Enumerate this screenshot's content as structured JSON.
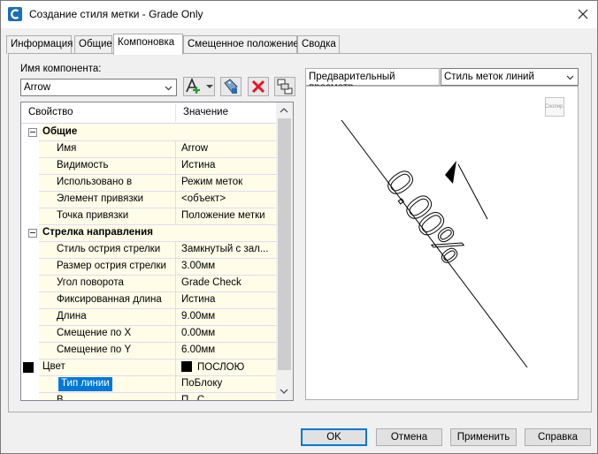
{
  "window": {
    "title": "Создание стиля метки - Grade Only"
  },
  "tabs": [
    {
      "label": "Информация"
    },
    {
      "label": "Общие"
    },
    {
      "label": "Компоновка"
    },
    {
      "label": "Смещенное положение"
    },
    {
      "label": "Сводка"
    }
  ],
  "active_tab": "Компоновка",
  "component": {
    "label": "Имя компонента:",
    "value": "Arrow"
  },
  "grid": {
    "headers": {
      "property": "Свойство",
      "value": "Значение"
    },
    "categories": [
      {
        "title": "Общие",
        "rows": [
          {
            "name": "Имя",
            "value": "Arrow"
          },
          {
            "name": "Видимость",
            "value": "Истина"
          },
          {
            "name": "Использовано в",
            "value": "Режим меток"
          },
          {
            "name": "Элемент привязки",
            "value": "<объект>"
          },
          {
            "name": "Точка привязки",
            "value": "Положение метки"
          }
        ]
      },
      {
        "title": "Стрелка направления",
        "rows": [
          {
            "name": "Стиль острия стрелки",
            "value": "Замкнутый с зал..."
          },
          {
            "name": "Размер острия стрелки",
            "value": "3.00мм"
          },
          {
            "name": "Угол поворота",
            "value": "Grade Check"
          },
          {
            "name": "Фиксированная длина",
            "value": "Истина"
          },
          {
            "name": "Длина",
            "value": "9.00мм"
          },
          {
            "name": "Смещение по X",
            "value": "0.00мм"
          },
          {
            "name": "Смещение по Y",
            "value": "6.00мм"
          },
          {
            "name": "Цвет",
            "value": "ПОСЛОЮ"
          },
          {
            "name": "Тип линии",
            "value": "ПоБлоку"
          },
          {
            "name": "В...",
            "value": "П...С..."
          }
        ]
      }
    ],
    "selected_row": "Тип линии"
  },
  "preview": {
    "label": "Предварительный просмотр",
    "style_select": "Стиль меток линий",
    "label_text": "0.00%",
    "copy_button": "Скопир."
  },
  "buttons": {
    "ok": "OK",
    "cancel": "Отмена",
    "apply": "Применить",
    "help": "Справка"
  },
  "colors": {
    "selection": "#0078d7",
    "grid_row_bg": "#fffde8",
    "delete_red": "#e81123"
  }
}
